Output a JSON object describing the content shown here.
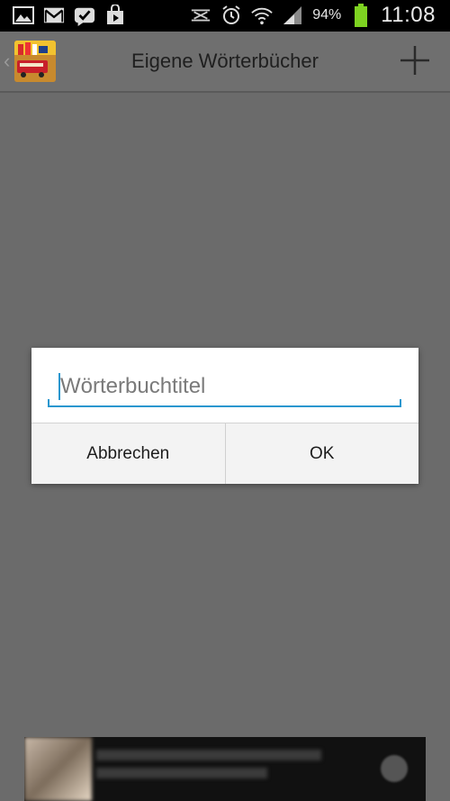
{
  "status_bar": {
    "icons_left": [
      "gallery-icon",
      "gmail-icon",
      "check-icon",
      "play-store-icon"
    ],
    "icons_right": [
      "nfc-icon",
      "alarm-icon",
      "wifi-icon",
      "signal-icon",
      "battery-icon"
    ],
    "battery_percent": "94%",
    "time": "11:08"
  },
  "app_bar": {
    "title": "Eigene Wörterbücher",
    "add_icon": "plus-icon"
  },
  "dialog": {
    "input_placeholder": "Wörterbuchtitel",
    "input_value": "",
    "cancel_label": "Abbrechen",
    "ok_label": "OK",
    "accent_color": "#2a97cf"
  }
}
